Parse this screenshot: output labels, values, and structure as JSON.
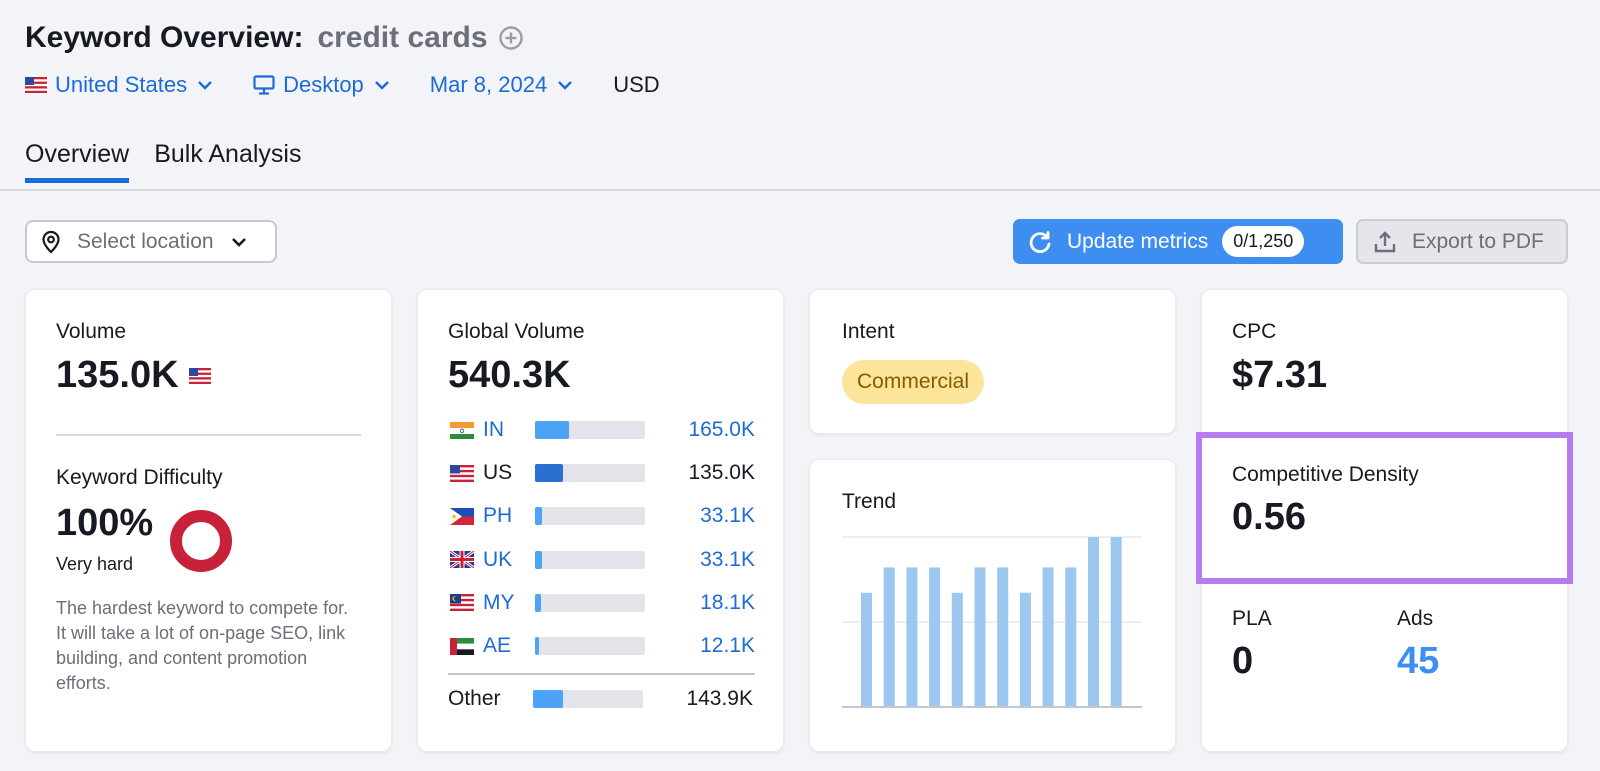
{
  "header": {
    "title": "Keyword Overview:",
    "keyword": "credit cards"
  },
  "filters": {
    "country": "United States",
    "device": "Desktop",
    "date": "Mar 8, 2024",
    "currency": "USD"
  },
  "tabs": [
    {
      "label": "Overview",
      "active": true
    },
    {
      "label": "Bulk Analysis",
      "active": false
    }
  ],
  "location_select": {
    "placeholder": "Select location"
  },
  "actions": {
    "update_label": "Update metrics",
    "update_badge": "0/1,250",
    "export_label": "Export to PDF"
  },
  "volume_card": {
    "label": "Volume",
    "value": "135.0K",
    "kd_label": "Keyword Difficulty",
    "kd_value": "100%",
    "kd_level": "Very hard",
    "kd_description": "The hardest keyword to compete for. It will take a lot of on-page SEO, link building, and content promotion efforts.",
    "kd_fraction": 1.0
  },
  "global_card": {
    "label": "Global Volume",
    "value": "540.3K",
    "countries": [
      {
        "code": "IN",
        "value": "165.0K",
        "share": 0.31,
        "link": true
      },
      {
        "code": "US",
        "value": "135.0K",
        "share": 0.25,
        "link": false
      },
      {
        "code": "PH",
        "value": "33.1K",
        "share": 0.06,
        "link": true
      },
      {
        "code": "UK",
        "value": "33.1K",
        "share": 0.06,
        "link": true
      },
      {
        "code": "MY",
        "value": "18.1K",
        "share": 0.05,
        "link": true
      },
      {
        "code": "AE",
        "value": "12.1K",
        "share": 0.04,
        "link": true
      }
    ],
    "other_label": "Other",
    "other_value": "143.9K",
    "other_share": 0.27
  },
  "intent_card": {
    "label": "Intent",
    "badge": "Commercial"
  },
  "trend_card": {
    "label": "Trend",
    "bars": [
      0.67,
      0.82,
      0.82,
      0.82,
      0.67,
      0.82,
      0.82,
      0.67,
      0.82,
      0.82,
      1.0,
      1.0
    ]
  },
  "cpc_card": {
    "cpc_label": "CPC",
    "cpc_value": "$7.31",
    "cd_label": "Competitive Density",
    "cd_value": "0.56",
    "pla_label": "PLA",
    "pla_value": "0",
    "ads_label": "Ads",
    "ads_value": "45"
  },
  "colors": {
    "accent": "#1d6bd6",
    "button_blue": "#3d8ef0",
    "kd_red": "#c8223a",
    "highlight_purple": "#b57cf2",
    "trend_bar": "#9cc7ee"
  }
}
